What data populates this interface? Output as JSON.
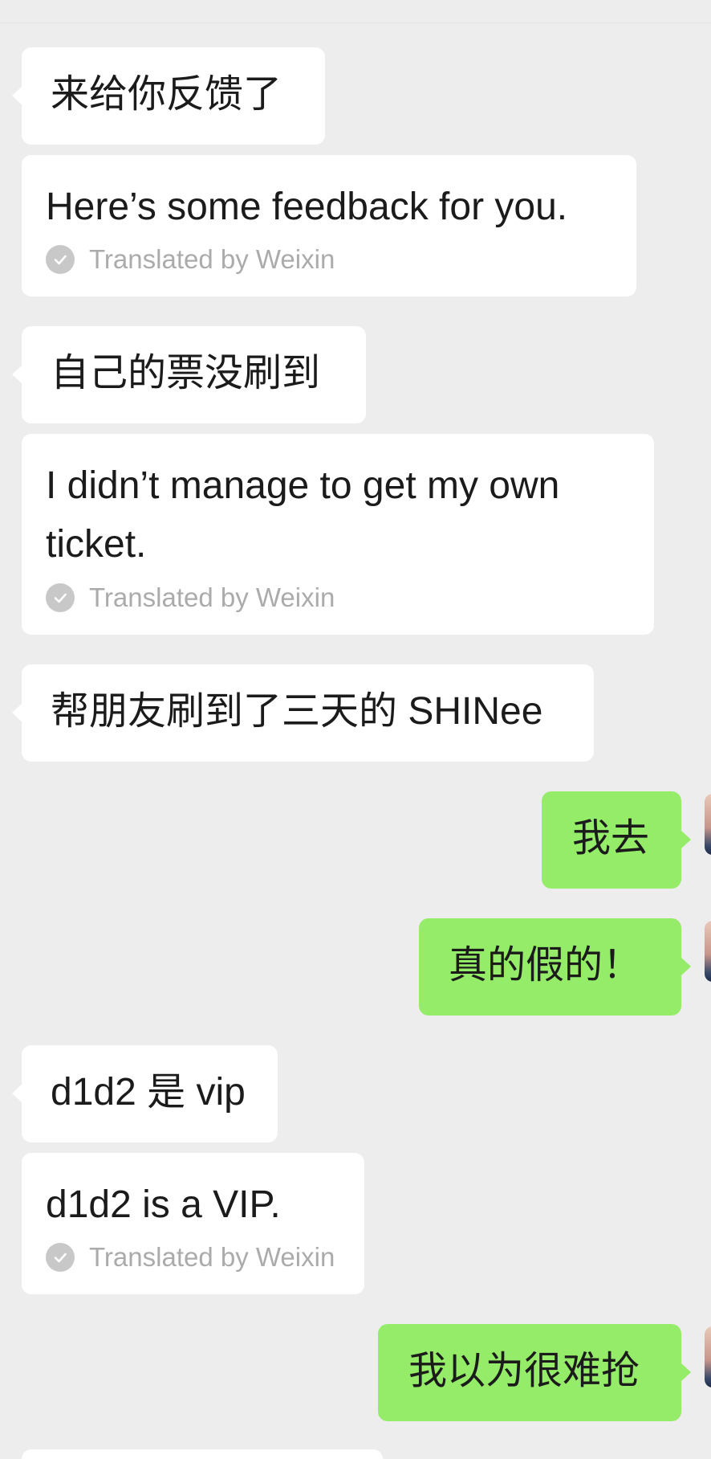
{
  "messages": [
    {
      "direction": "in",
      "text": "来给你反馈了",
      "translation": "Here’s some feedback for you."
    },
    {
      "direction": "in",
      "text": "自己的票没刷到",
      "translation": "I didn’t manage to get my own ticket."
    },
    {
      "direction": "in",
      "text": "帮朋友刷到了三天的 SHINee"
    },
    {
      "direction": "out",
      "text": "我去"
    },
    {
      "direction": "out",
      "text": "真的假的！"
    },
    {
      "direction": "in",
      "text": "d1d2 是 vip",
      "translation": "d1d2 is a VIP."
    },
    {
      "direction": "out",
      "text": "我以为很难抢"
    }
  ],
  "translation_credit": "Translated by Weixin",
  "colors": {
    "background": "#ededed",
    "incoming_bubble": "#ffffff",
    "outgoing_bubble": "#95ec69",
    "credit_text": "#ababab"
  },
  "icons": [
    "check-circle-icon",
    "avatar"
  ]
}
